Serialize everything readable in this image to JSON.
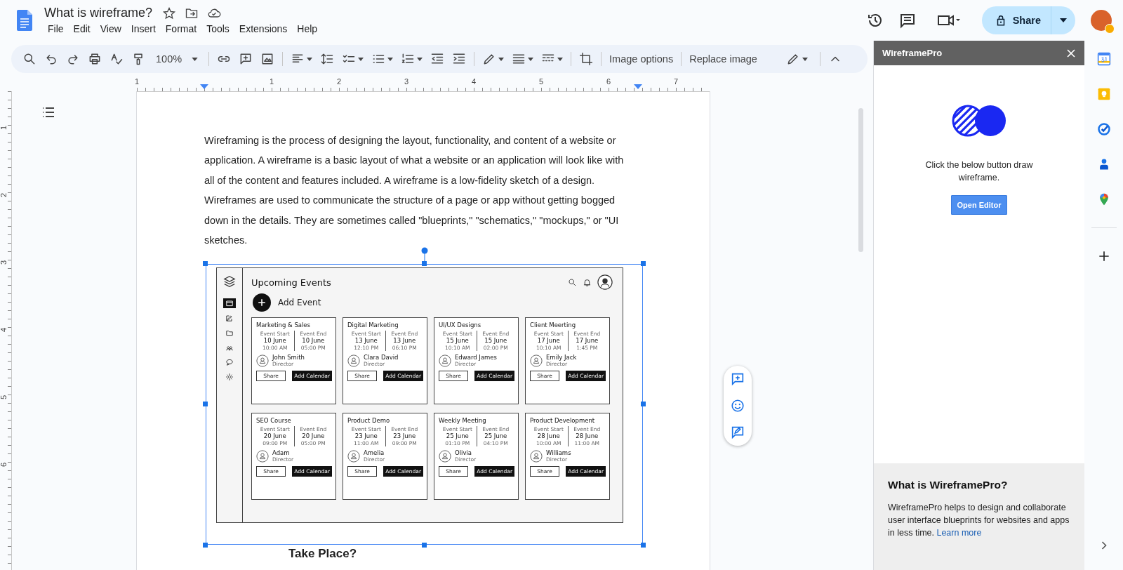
{
  "document": {
    "title": "What is wireframe?"
  },
  "menu": [
    "File",
    "Edit",
    "View",
    "Insert",
    "Format",
    "Tools",
    "Extensions",
    "Help"
  ],
  "share_button": "Share",
  "toolbar": {
    "zoom": "100%",
    "image_options": "Image options",
    "replace_image": "Replace image"
  },
  "ruler": {
    "horizontal": [
      "1",
      "1",
      "2",
      "3",
      "4",
      "5",
      "6",
      "7"
    ],
    "vertical": [
      "1",
      "2",
      "3",
      "4",
      "5",
      "6"
    ]
  },
  "body": {
    "paragraph": "Wireframing is the process of designing the layout, functionality, and content of a website or application. A wireframe is a basic layout of what a website or an application will look like with all of the content and features included. A wireframe is a low-fidelity sketch of a design. Wireframes are used to communicate the structure of a page or app without getting bogged down in the details. They are sometimes called \"blueprints,\" \"schematics,\" \"mockups,\" or \"UI sketches.",
    "heading": "Take Place?"
  },
  "wireframe": {
    "title": "Upcoming Events",
    "add_button": "Add Event",
    "nav": [
      {
        "selected": true
      },
      {
        "selected": false
      },
      {
        "selected": false
      },
      {
        "selected": false
      },
      {
        "selected": false
      },
      {
        "selected": false
      }
    ],
    "cards": [
      {
        "title": "Marketing & Sales",
        "start_label": "Event Start",
        "start_date": "10 June",
        "start_time": "10:00 AM",
        "end_label": "Event End",
        "end_date": "10 June",
        "end_time": "05:00 PM",
        "name": "John Smith",
        "role": "Director",
        "share": "Share",
        "add": "Add Calendar"
      },
      {
        "title": "Digital Marketing",
        "start_label": "Event Start",
        "start_date": "13 June",
        "start_time": "12:10 PM",
        "end_label": "Event End",
        "end_date": "13 June",
        "end_time": "06:10 PM",
        "name": "Clara David",
        "role": "Director",
        "share": "Share",
        "add": "Add Calendar"
      },
      {
        "title": "UI/UX Designs",
        "start_label": "Event Start",
        "start_date": "15 June",
        "start_time": "10:10 AM",
        "end_label": "Event End",
        "end_date": "15 June",
        "end_time": "02:00 PM",
        "name": "Edward James",
        "role": "Director",
        "share": "Share",
        "add": "Add Calendar"
      },
      {
        "title": "Client Meerting",
        "start_label": "Event Start",
        "start_date": "17 June",
        "start_time": "10:10 AM",
        "end_label": "Event End",
        "end_date": "17 June",
        "end_time": "1:45 PM",
        "name": "Emily Jack",
        "role": "Director",
        "share": "Share",
        "add": "Add Calendar"
      },
      {
        "title": "SEO Course",
        "start_label": "Event Start",
        "start_date": "20 June",
        "start_time": "09:00 PM",
        "end_label": "Event End",
        "end_date": "20 June",
        "end_time": "05:00 PM",
        "name": "Adam",
        "role": "Director",
        "share": "Share",
        "add": "Add Calendar"
      },
      {
        "title": "Product Demo",
        "start_label": "Event Start",
        "start_date": "23 June",
        "start_time": "11:00 AM",
        "end_label": "Event End",
        "end_date": "23 June",
        "end_time": "09:00 PM",
        "name": "Amelia",
        "role": "Director",
        "share": "Share",
        "add": "Add Calendar"
      },
      {
        "title": "Weekly Meeting",
        "start_label": "Event Start",
        "start_date": "25 June",
        "start_time": "01:10 PM",
        "end_label": "Event End",
        "end_date": "25 June",
        "end_time": "04:10 PM",
        "name": "Olivia",
        "role": "Director",
        "share": "Share",
        "add": "Add Calendar"
      },
      {
        "title": "Product Development",
        "start_label": "Event Start",
        "start_date": "28 June",
        "start_time": "10:00 AM",
        "end_label": "Event End",
        "end_date": "28 June",
        "end_time": "11:00 AM",
        "name": "Williams",
        "role": "Director",
        "share": "Share",
        "add": "Add Calendar"
      }
    ]
  },
  "side_panel": {
    "title": "WireframePro",
    "message": "Click the below button draw wireframe.",
    "button": "Open Editor",
    "info_title": "What is WireframePro?",
    "info_text": "WireframePro helps to design and collaborate user interface blueprints for websites and apps in less time.",
    "info_link": "Learn more"
  }
}
